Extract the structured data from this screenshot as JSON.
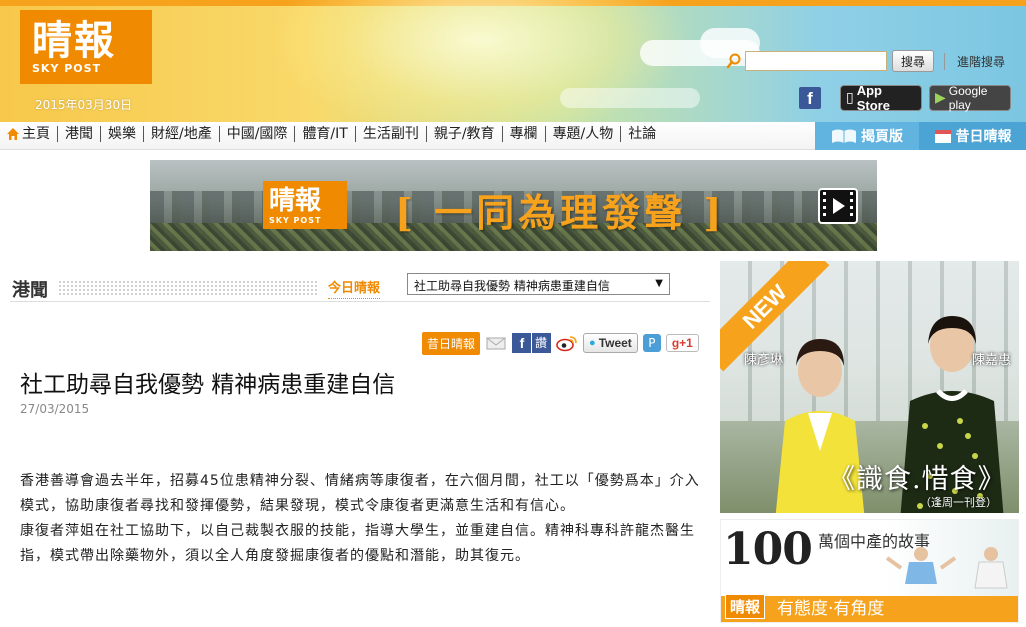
{
  "header": {
    "logo_cn": "晴報",
    "logo_en": "SKY POST",
    "date": "2015年03月30日",
    "search": {
      "placeholder": "",
      "button": "搜尋",
      "advanced": "進階搜尋"
    },
    "apps": {
      "facebook": "f",
      "app_store": "App Store",
      "google_play": "Google play"
    }
  },
  "nav": {
    "items": [
      "主頁",
      "港聞",
      "娛樂",
      "財經/地產",
      "中國/國際",
      "體育/IT",
      "生活副刊",
      "親子/教育",
      "專欄",
      "專題/人物",
      "社論"
    ],
    "right_tabs": [
      "揭頁版",
      "昔日晴報"
    ]
  },
  "banner": {
    "logo_cn": "晴報",
    "logo_en": "SKY POST",
    "slogan": "[ 一同為理發聲 ]"
  },
  "section": {
    "title": "港聞",
    "today_link": "今日晴報",
    "article_select": "社工助尋自我優勢 精神病患重建自信"
  },
  "share": {
    "past_button": "昔日晴報",
    "fb_label": "讚",
    "tweet": "Tweet",
    "gplus": "g+1"
  },
  "article": {
    "headline": "社工助尋自我優勢 精神病患重建自信",
    "date": "27/03/2015",
    "paragraphs": [
      "香港善導會過去半年，招募45位患精神分裂、情緒病等康復者，在六個月間，社工以「優勢爲本」介入模式，協助康復者尋找和發揮優勢，結果發現，模式令康復者更滿意生活和有信心。",
      "康復者萍姐在社工協助下，以自己裁製衣服的技能，指導大學生，並重建自信。精神科專科許龍杰醫生指，模式帶出除藥物外，須以全人角度發掘康復者的優點和潛能，助其復元。"
    ]
  },
  "ads": {
    "ad1": {
      "ribbon": "NEW",
      "name1": "陳彥琳",
      "name2": "陳嘉惠",
      "title": "《識食.惜食》",
      "subtitle": "（逢周一刊登）"
    },
    "ad2": {
      "number": "100",
      "headline": "萬個中產的故事",
      "logo": "晴報",
      "tagline": "有態度·有角度"
    }
  },
  "colors": {
    "brand_orange": "#f08a00",
    "nav_blue": "#62b4e0",
    "facebook": "#3b5998"
  }
}
